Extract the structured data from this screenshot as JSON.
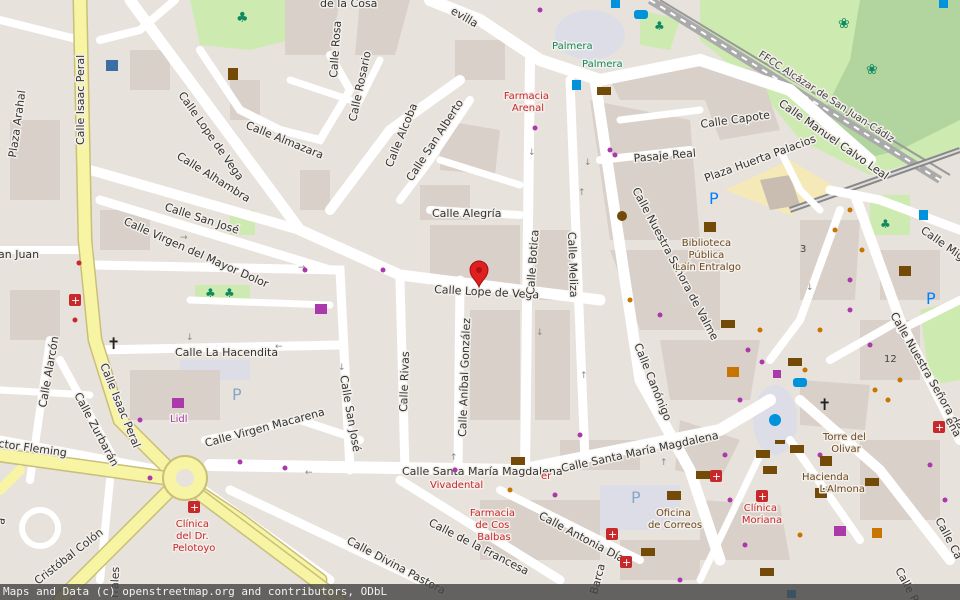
{
  "streets": {
    "isaac_peral_top": "Calle Isaac Peral",
    "isaac_peral_bottom": "Calle Isaac Peral",
    "lope_de_vega_top": "Calle Lope de Vega",
    "lope_de_vega_main": "Calle Lope de Vega",
    "almazara": "Calle Almazara",
    "rosa": "Calle Rosa",
    "rosario": "Calle Rosario",
    "alcoba": "Calle Alcoba",
    "san_alberto": "Calle San Alberto",
    "alhambra": "Calle Alhambra",
    "san_jose": "Calle San José",
    "san_jose_v": "Calle San José",
    "virgen_mayor_dolor": "Calle Virgen del Mayor Dolor",
    "alegria": "Calle Alegría",
    "botica": "Calle Botica",
    "meliza": "Calle Meliza",
    "anibal_gonzalez": "Calle Aníbal González",
    "rivas": "Calle Rivas",
    "la_hacendita": "Calle La Hacendita",
    "alarcon": "Calle Alarcón",
    "zurbaran": "Calle Zurbarán",
    "virgen_macarena": "Calle Virgen Macarena",
    "santa_maria_magdalena_w": "Calle Santa María Magdalena",
    "santa_maria_magdalena_e": "Calle Santa María Magdalena",
    "canonigo": "Calle Canónigo",
    "nuestra_senora_valme": "Calle Nuestra Señora de Valme",
    "nuestra_senora_valme_e": "Calle Nuestra Señora de Valme",
    "pasaje_real": "Pasaje Real",
    "plaza_huerta_palacios": "Plaza Huerta Palacios",
    "capote": "Calle Capote",
    "manuel_calvo_leal": "Calle Manuel Calvo Leal",
    "ffcc": "FFCC Alcázar de San Juan-Cádiz",
    "plaza_arahal": "Plaza Arahal",
    "san_juan": "an Juan",
    "fleming": "ctor Fleming",
    "antonia_diaz": "Calle Antonia Díaz",
    "de_la_francesa": "Calle de la Francesa",
    "divina_pastora": "Calle Divina Pastora",
    "cristobal_colon": "Cristóbal Colón",
    "sevilla": "evilla",
    "la_cosa": "de la Cosa",
    "barca": "Barca",
    "migu": "Calle Migu",
    "ca_right": "Calle Ca",
    "rolls": "rrales",
    "a_left": "a",
    "ena": "ena",
    "ramos": "Calle Ra"
  },
  "pois": {
    "palmera1": "Palmera",
    "palmera2": "Palmera",
    "farmacia_arenal": [
      "Farmacia",
      "Arenal"
    ],
    "biblioteca": [
      "Biblioteca",
      "Pública",
      "Laín Entralgo"
    ],
    "lidl": "Lidl",
    "clinica_pelotoyo": [
      "Clínica",
      "del Dr.",
      "Pelotoyo"
    ],
    "vivadental": "Vivadental",
    "farmacia_cos_balbas": [
      "Farmacia",
      "de Cos",
      "Balbas"
    ],
    "oficina_correos": [
      "Oficina",
      "de Correos"
    ],
    "clinica_moriana": [
      "Clínica",
      "Moriana"
    ],
    "torre_olivar": [
      "Torre del",
      "Olivar"
    ],
    "hacienda_almona": [
      "Hacienda",
      "La",
      "Almona"
    ],
    "house_3": "3",
    "house_12": "12",
    "er": "er"
  },
  "marker": {
    "label": "location-marker",
    "color": "#e02020"
  },
  "colors": {
    "background": "#e8e2dc",
    "road_white": "#ffffff",
    "road_yellow": "#f7f4a4",
    "park": "#cdebb0",
    "forest": "#add19e",
    "building": "#d9d0c9",
    "square": "#dddde8"
  },
  "attribution": "Maps and Data (c) openstreetmap.org and contributors, ODbL"
}
